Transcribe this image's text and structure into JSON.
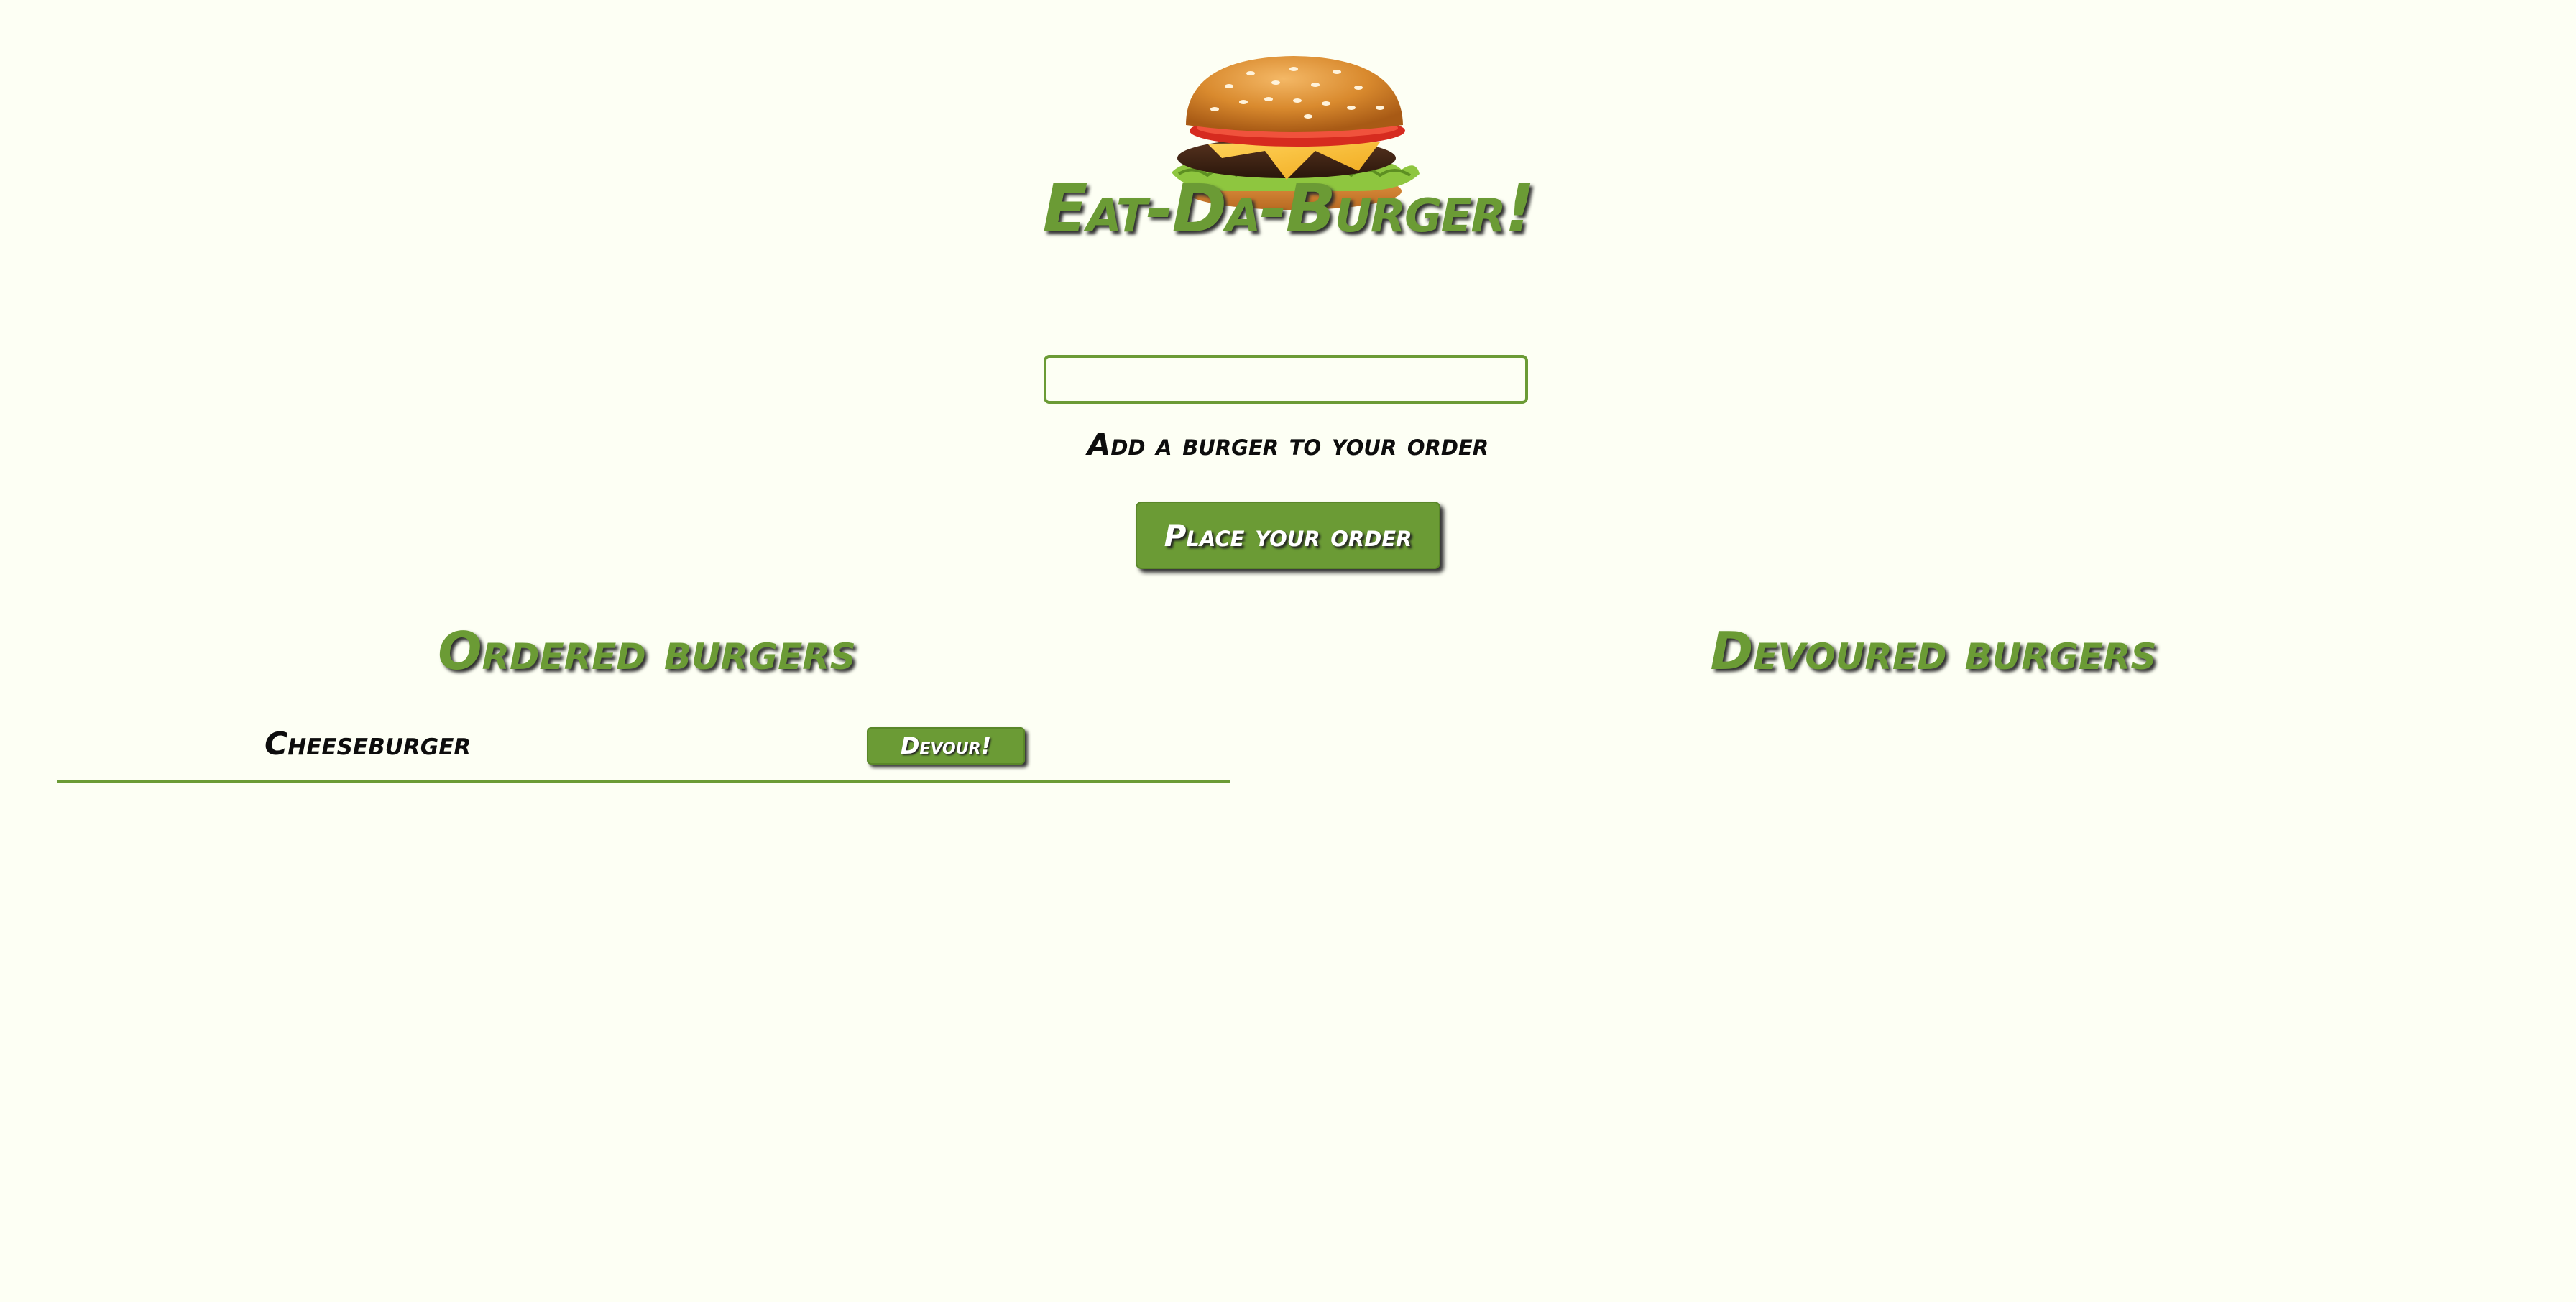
{
  "header": {
    "title": "Eat-Da-Burger!",
    "logo": "burger-logo"
  },
  "form": {
    "input_value": "",
    "input_label": "Add a burger to your order",
    "submit_label": "Place your order"
  },
  "ordered": {
    "heading": "Ordered burgers",
    "items": [
      {
        "name": "Cheeseburger",
        "button_label": "Devour!"
      }
    ]
  },
  "devoured": {
    "heading": "Devoured burgers",
    "items": []
  },
  "colors": {
    "background": "#fdfff4",
    "accent": "#6b9b35",
    "text": "#0d0d0d"
  }
}
